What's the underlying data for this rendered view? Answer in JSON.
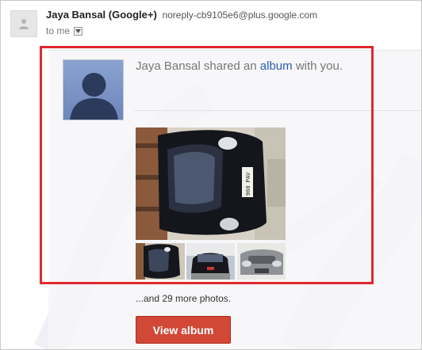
{
  "header": {
    "sender_name": "Jaya Bansal (Google+)",
    "sender_email": "noreply-cb9105e6@plus.google.com",
    "recipient_label": "to me"
  },
  "share": {
    "intro_text": "Jaya Bansal shared an",
    "link_text": "album",
    "suffix_text": "with you."
  },
  "photos": {
    "license_plate": "960 PAV",
    "more_text": "...and 29 more photos."
  },
  "actions": {
    "view_album_label": "View album"
  },
  "colors": {
    "button": "#d14836",
    "link": "#2a5db0",
    "highlight": "#e0282e"
  },
  "icons": {
    "sender_avatar": "person-icon",
    "recipient_dropdown": "chevron-down-icon"
  }
}
